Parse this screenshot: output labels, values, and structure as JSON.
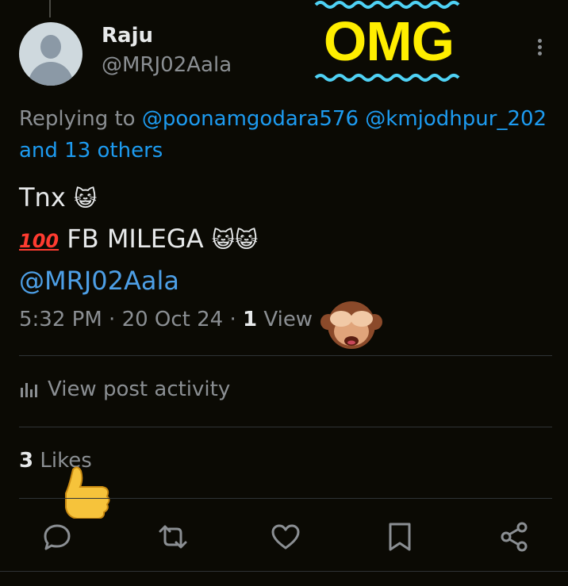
{
  "author": {
    "name": "Raju",
    "handle": "@MRJ02Aala"
  },
  "sticker": {
    "text": "OMG"
  },
  "reply": {
    "prefix": "Replying to",
    "mentions": "@poonamgodara576 @kmjodhpur_202",
    "others": "and 13 others"
  },
  "post": {
    "line1": "Tnx",
    "line2": "FB MILEGA",
    "hundred": "100",
    "mention": "@MRJ02Aala",
    "emoji_cat": "😺"
  },
  "meta": {
    "time": "5:32 PM",
    "date": "20 Oct 24",
    "views_count": "1",
    "views_label": "View"
  },
  "activity": {
    "label": "View post activity"
  },
  "likes": {
    "count": "3",
    "label": "Likes"
  },
  "actions": [
    "reply-icon",
    "repost-icon",
    "like-icon",
    "bookmark-icon",
    "share-icon"
  ],
  "colors": {
    "background": "#0b0a04",
    "link": "#1d9bf0",
    "muted": "#8b8f93",
    "sticker_yellow": "#ffee00",
    "sticker_wave": "#4fd2f5"
  }
}
